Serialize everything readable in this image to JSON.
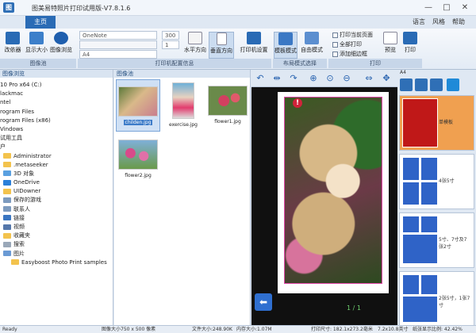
{
  "app": {
    "title": "图美易特照片打印试用版-V7.8.1.6"
  },
  "window": {
    "minimize": "—",
    "maximize": "□",
    "close": "✕"
  },
  "ribbon": {
    "tab_main": "主页",
    "right_links": [
      "语言",
      "风格",
      "帮助"
    ],
    "buttons": {
      "modify": "改依器",
      "show_size": "显示大小",
      "image_browse": "图像浏览",
      "horizontal": "水平方向",
      "vertical": "垂直方向",
      "printer_settings": "打印机设置",
      "template_mode": "模板模式",
      "free_mode": "自由模式",
      "preview": "预览",
      "print": "打印"
    },
    "printer_name": "OneNote",
    "paper_size": "A4",
    "dpi": "300",
    "copies": "1",
    "checks": {
      "print_current": "打印当前页面",
      "print_all": "全部打印",
      "add_border": "添加细边框"
    },
    "groups": {
      "image": "图像池",
      "print_config": "打印机配置信息",
      "layout_mode": "布局模式选择",
      "print": "打印"
    }
  },
  "left_panel": {
    "header": "图像浏览",
    "tree": [
      "10 Pro x64 (C:)",
      "lackmac",
      "ntel",
      "rogram Files",
      "rogram Files (x86)",
      "Vindows",
      "试用工具",
      "户",
      "Administrator",
      ".metaseeker",
      "3D 对象",
      "OneDrive",
      "UIDowner",
      "保存的游戏",
      "联系人",
      "链接",
      "视频",
      "收藏夹",
      "搜索",
      "图片",
      "Easyboost Photo Print samples"
    ]
  },
  "thumb_panel": {
    "header": "图像池",
    "items": [
      {
        "caption": "childen.jpg"
      },
      {
        "caption": "exercise.jpg"
      },
      {
        "caption": "flower1.jpg"
      },
      {
        "caption": "flower2.jpg"
      }
    ]
  },
  "preview": {
    "page_indicator": "1 / 1"
  },
  "templates": {
    "paper": "A4",
    "items": [
      {
        "label": "单模板"
      },
      {
        "label": "4张5寸"
      },
      {
        "label": "5寸、7寸及7张2寸"
      },
      {
        "label": "2张5寸，1张7寸"
      }
    ]
  },
  "status": {
    "ready": "Ready",
    "image_size": "图像大小750 x 500 像素",
    "file_size": "文件大小:248.90K",
    "memory": "内存大小:1.07M",
    "print_size": "打印尺寸: 182.1x273.2毫米",
    "print_size_in": "7.2x10.8英寸",
    "paper_ratio": "纸张显示比例: 42.42%"
  }
}
